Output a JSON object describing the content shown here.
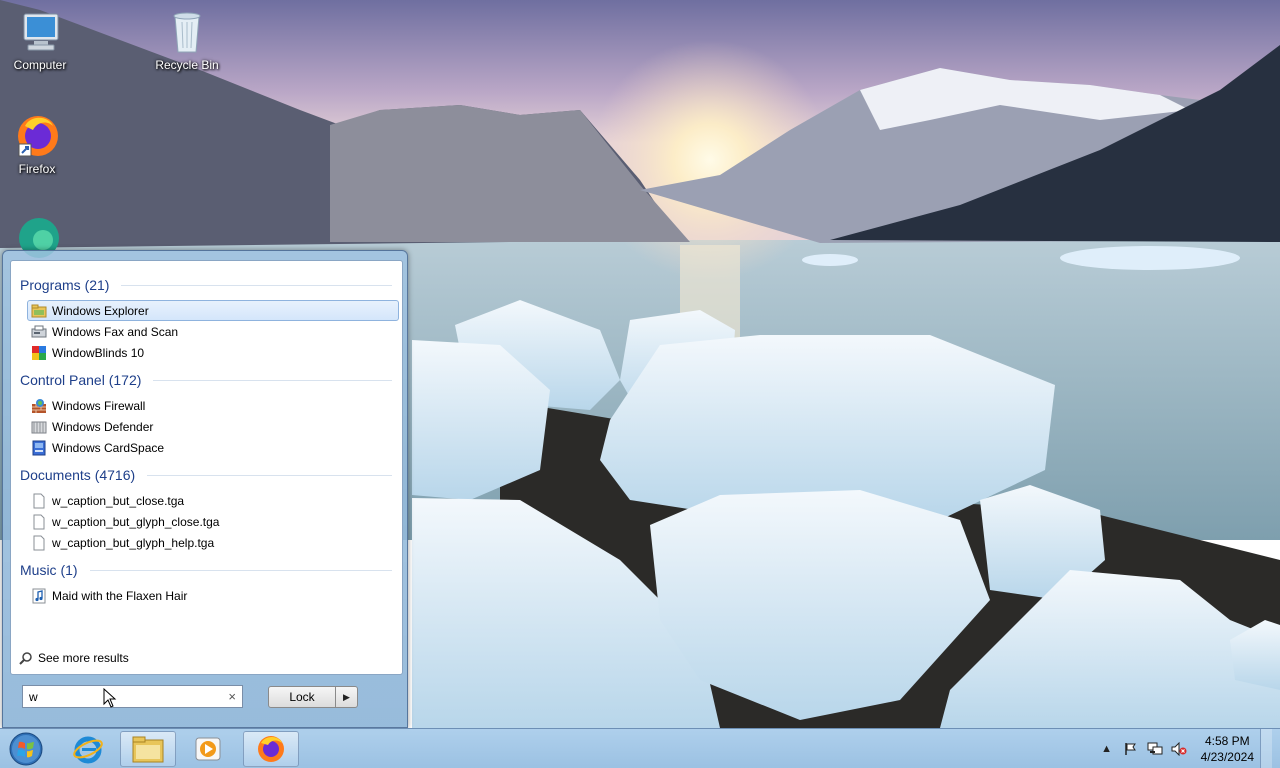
{
  "desktop": {
    "icons": [
      {
        "label": "Computer",
        "icon": "computer-icon"
      },
      {
        "label": "Recycle Bin",
        "icon": "recycle-bin-icon"
      },
      {
        "label": "Firefox",
        "icon": "firefox-icon"
      },
      {
        "label": "",
        "icon": "edge-icon"
      }
    ]
  },
  "start_menu": {
    "groups": [
      {
        "header": "Programs (21)",
        "items": [
          {
            "label": "Windows Explorer",
            "icon": "folder-explorer-icon",
            "selected": true
          },
          {
            "label": "Windows Fax and Scan",
            "icon": "fax-scan-icon"
          },
          {
            "label": "WindowBlinds 10",
            "icon": "windowblinds-icon"
          }
        ]
      },
      {
        "header": "Control Panel (172)",
        "items": [
          {
            "label": "Windows Firewall",
            "icon": "firewall-icon"
          },
          {
            "label": "Windows Defender",
            "icon": "defender-icon"
          },
          {
            "label": "Windows CardSpace",
            "icon": "cardspace-icon"
          }
        ]
      },
      {
        "header": "Documents (4716)",
        "items": [
          {
            "label": "w_caption_but_close.tga",
            "icon": "document-icon"
          },
          {
            "label": "w_caption_but_glyph_close.tga",
            "icon": "document-icon"
          },
          {
            "label": "w_caption_but_glyph_help.tga",
            "icon": "document-icon"
          }
        ]
      },
      {
        "header": "Music (1)",
        "items": [
          {
            "label": "Maid with the Flaxen Hair",
            "icon": "music-note-icon"
          }
        ]
      }
    ],
    "see_more": "See more results",
    "search": {
      "value": "w",
      "clear_glyph": "×"
    },
    "lock_button": "Lock",
    "lock_arrow_glyph": "▶"
  },
  "taskbar": {
    "pinned": [
      {
        "name": "internet-explorer",
        "icon": "internet-explorer-icon"
      },
      {
        "name": "file-explorer",
        "icon": "file-explorer-icon",
        "active": true
      },
      {
        "name": "media-player",
        "icon": "media-player-icon"
      },
      {
        "name": "firefox",
        "icon": "firefox-icon",
        "active": true
      }
    ],
    "tray": {
      "overflow_glyph": "▲",
      "time": "4:58 PM",
      "date": "4/23/2024"
    }
  },
  "colors": {
    "group_header": "#1e3f8a",
    "selection_bg": "#d4e6fb",
    "selection_border": "#8fb3de",
    "taskbar": "#a6c8e8"
  }
}
